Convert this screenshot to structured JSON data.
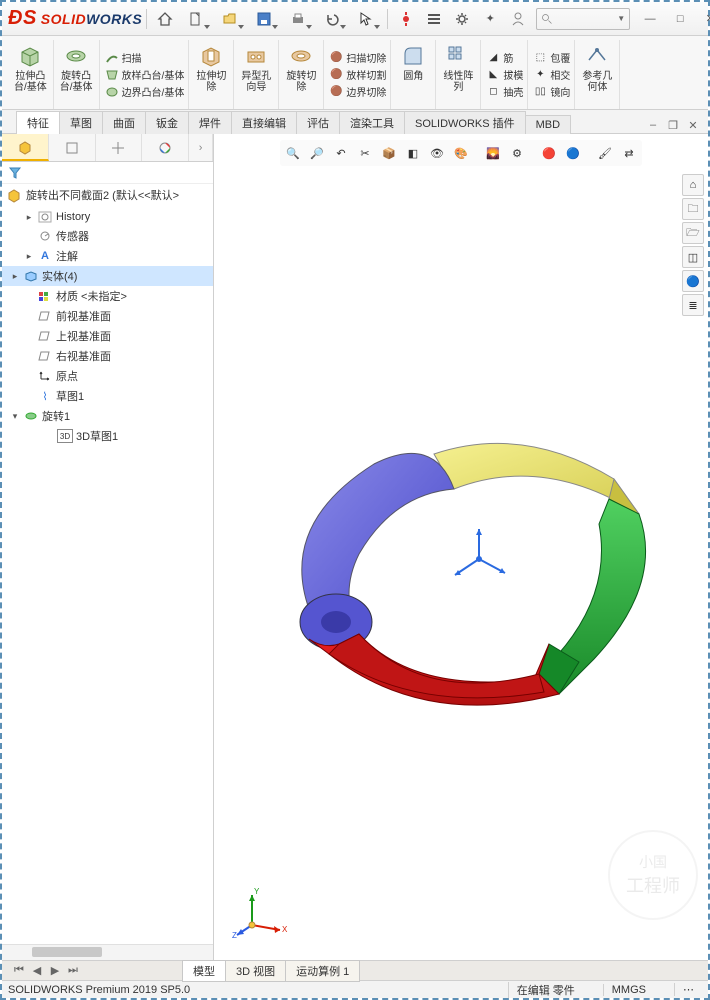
{
  "app": {
    "name_solid": "SOLID",
    "name_works": "WORKS"
  },
  "search": {
    "placeholder": ""
  },
  "ribbon": {
    "extrude": "拉伸凸\n台/基体",
    "revolve": "旋转凸\n台/基体",
    "sweep": "扫描",
    "loft": "放样凸台/基体",
    "boundary": "边界凸台/基体",
    "extcut": "拉伸切\n除",
    "wizard": "异型孔\n向导",
    "revcut": "旋转切\n除",
    "sweepcut": "扫描切除",
    "loftcut": "放样切割",
    "boundcut": "边界切除",
    "fillet": "圆角",
    "pattern": "线性阵\n列",
    "rib": "筋",
    "draft": "拔模",
    "shell": "抽壳",
    "wrap": "包覆",
    "intersect": "相交",
    "mirror": "镜向",
    "refgeom": "参考几\n何体"
  },
  "tabs": [
    "特征",
    "草图",
    "曲面",
    "钣金",
    "焊件",
    "直接编辑",
    "评估",
    "渲染工具",
    "SOLIDWORKS 插件",
    "MBD"
  ],
  "tree": {
    "root": "旋转出不同截面2  (默认<<默认>",
    "history": "History",
    "sensors": "传感器",
    "annotations": "注解",
    "solids": "实体(4)",
    "material": "材质 <未指定>",
    "front": "前视基准面",
    "top": "上视基准面",
    "right": "右视基准面",
    "origin": "原点",
    "sketch1": "草图1",
    "revolve1": "旋转1",
    "sketch3d": "3D草图1"
  },
  "bottom": {
    "model": "模型",
    "view3d": "3D 视图",
    "motion": "运动算例 1"
  },
  "status": {
    "version": "SOLIDWORKS Premium 2019 SP5.0",
    "edit": "在编辑 零件",
    "units": "MMGS"
  },
  "watermark": {
    "l1": "小国",
    "l2": "工程师"
  }
}
